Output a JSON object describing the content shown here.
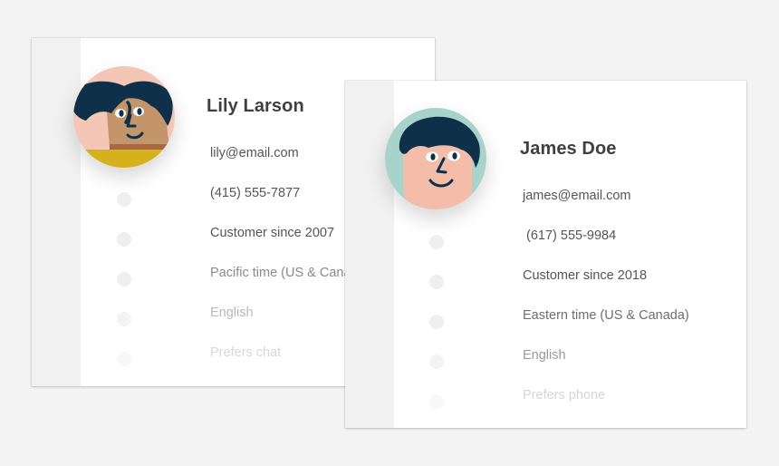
{
  "cards": [
    {
      "name": "Lily Larson",
      "avatar": "woman-avatar",
      "avatar_bg": "#f4c6b6",
      "fields": {
        "email": "lily@email.com",
        "phone": "(415) 555-7877",
        "since": "Customer since 2007",
        "timezone": "Pacific time (US & Canada)",
        "language": "English",
        "preference": "Prefers chat"
      }
    },
    {
      "name": "James Doe",
      "avatar": "man-avatar",
      "avatar_bg": "#a7d3cb",
      "fields": {
        "email": "james@email.com",
        "phone": " (617) 555-9984",
        "since": "Customer since 2018",
        "timezone": "Eastern time (US & Canada)",
        "language": "English",
        "preference": "Prefers phone"
      }
    }
  ]
}
